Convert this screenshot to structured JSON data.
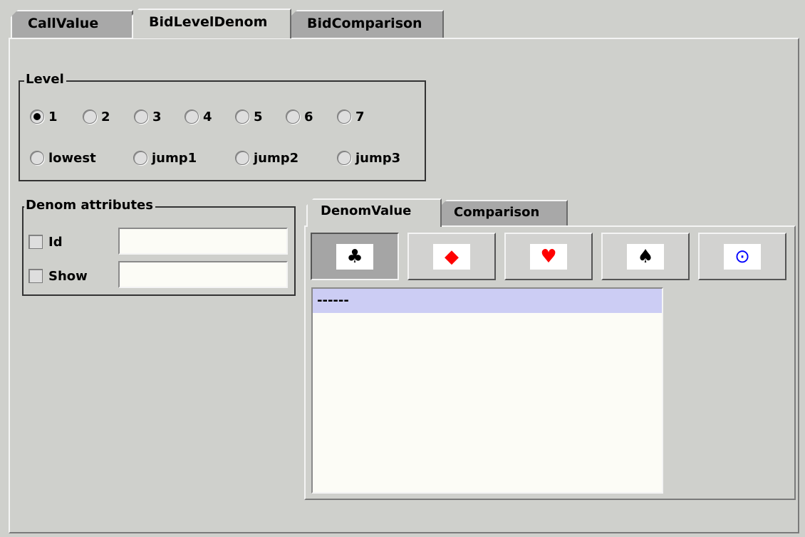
{
  "tabs": [
    "CallValue",
    "BidLevelDenom",
    "BidComparison"
  ],
  "active_tab": "BidLevelDenom",
  "level": {
    "legend": "Level",
    "levels": [
      "1",
      "2",
      "3",
      "4",
      "5",
      "6",
      "7"
    ],
    "selected_level": "1",
    "modes": [
      "lowest",
      "jump1",
      "jump2",
      "jump3"
    ]
  },
  "denom_attributes": {
    "legend": "Denom attributes",
    "id_label": "Id",
    "id_value": "",
    "show_label": "Show",
    "show_value": ""
  },
  "inner_tabs": [
    "DenomValue",
    "Comparison"
  ],
  "active_inner_tab": "DenomValue",
  "suits": [
    {
      "symbol": "♣",
      "icon": "club-icon",
      "color": "#000000",
      "pressed": true
    },
    {
      "symbol": "◆",
      "icon": "diamond-icon",
      "color": "#ff0000",
      "pressed": false
    },
    {
      "symbol": "♥",
      "icon": "heart-icon",
      "color": "#ff0000",
      "pressed": false
    },
    {
      "symbol": "♠",
      "icon": "spade-icon",
      "color": "#000000",
      "pressed": false
    },
    {
      "symbol": "⊙",
      "icon": "notrump-icon",
      "color": "#0000ff",
      "pressed": false
    }
  ],
  "list": {
    "items": [
      "------"
    ],
    "selected_index": 0
  }
}
